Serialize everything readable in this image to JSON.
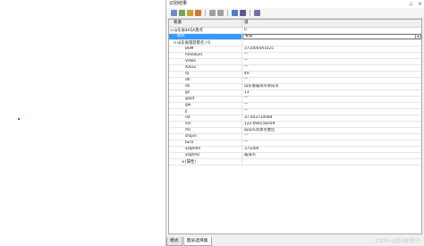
{
  "panel": {
    "title": "识别结果",
    "window_buttons": [
      "pin-icon",
      "close-icon"
    ]
  },
  "toolbar": {
    "icons": [
      {
        "name": "expand-all-icon",
        "color": "#6a8fbf"
      },
      {
        "name": "collapse-all-icon",
        "color": "#7f9f5f"
      },
      {
        "name": "select-icon",
        "color": "#c9a032"
      },
      {
        "name": "flash-icon",
        "color": "#d07a2a"
      },
      {
        "name": "sep"
      },
      {
        "name": "prev-icon",
        "color": "#a0a0a0"
      },
      {
        "name": "next-icon",
        "color": "#a0a0a0"
      },
      {
        "name": "sep"
      },
      {
        "name": "zoom-to-icon",
        "color": "#4f7fbf"
      },
      {
        "name": "identify-icon",
        "color": "#5a5a8a"
      },
      {
        "name": "sep"
      },
      {
        "name": "copy-icon",
        "color": "#6f6faf"
      }
    ]
  },
  "grid": {
    "col_field": "要素",
    "col_value": "值",
    "rows": [
      {
        "level": 0,
        "expander": "⊟",
        "field": "山东省4A5A景点",
        "value": "0"
      },
      {
        "level": 1,
        "expander": "",
        "field": "模式",
        "value": "要素",
        "selected": true
      },
      {
        "level": 1,
        "expander": "⊟",
        "field": "山东省旅游景点 / 0",
        "value": ""
      },
      {
        "level": 2,
        "expander": "",
        "field": "BSM",
        "value": "3710004A1025"
      },
      {
        "level": 2,
        "expander": "",
        "field": "hmoduel",
        "value": "\"\""
      },
      {
        "level": 2,
        "expander": "",
        "field": "Video",
        "value": "\"\""
      },
      {
        "level": 2,
        "expander": "",
        "field": "XXDZ",
        "value": "\"\""
      },
      {
        "level": 2,
        "expander": "",
        "field": "dj",
        "value": "4A"
      },
      {
        "level": 2,
        "expander": "",
        "field": "dh",
        "value": "\"\""
      },
      {
        "level": 2,
        "expander": "",
        "field": "dz",
        "value": "山东省威海市荣成市"
      },
      {
        "level": 2,
        "expander": "",
        "field": "gc",
        "value": "13"
      },
      {
        "level": 2,
        "expander": "",
        "field": "gsjld",
        "value": "\"\""
      },
      {
        "level": 2,
        "expander": "",
        "field": "gw",
        "value": "\"\""
      },
      {
        "level": 2,
        "expander": "",
        "field": "jj",
        "value": "\"\""
      },
      {
        "level": 2,
        "expander": "",
        "field": "lat",
        "value": "37.403710084"
      },
      {
        "level": 2,
        "expander": "",
        "field": "lon",
        "value": "122.694258359"
      },
      {
        "level": 2,
        "expander": "",
        "field": "mc",
        "value": "成山头风景名胜区"
      },
      {
        "level": 2,
        "expander": "",
        "field": "shipin",
        "value": "\"\""
      },
      {
        "level": 2,
        "expander": "",
        "field": "tuce",
        "value": "\"\""
      },
      {
        "level": 2,
        "expander": "",
        "field": "xzqhdm",
        "value": "371000"
      },
      {
        "level": 2,
        "expander": "",
        "field": "xzqhmc",
        "value": "威海市"
      },
      {
        "level": 2,
        "expander": "⊞",
        "field": "(属性)",
        "value": ""
      }
    ]
  },
  "tabs": [
    {
      "label": "模式",
      "active": false
    },
    {
      "label": "图层选择集",
      "active": true
    }
  ],
  "watermark": "CSDN @影羽的兔子"
}
